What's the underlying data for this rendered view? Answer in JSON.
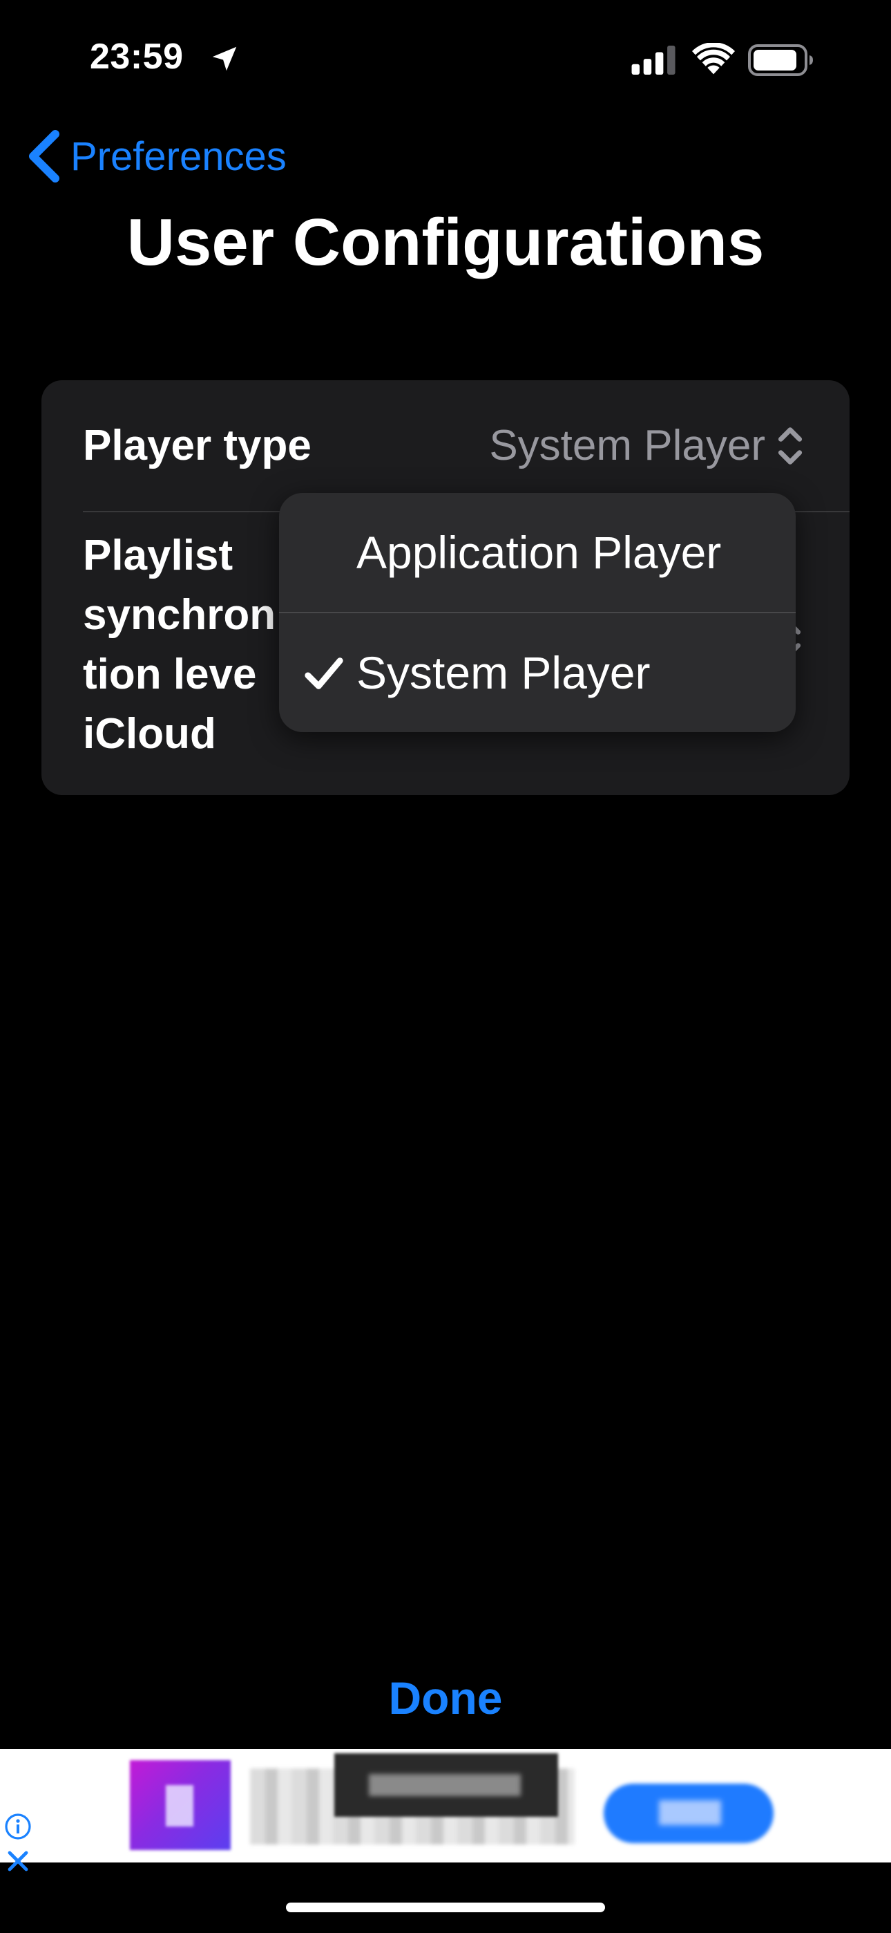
{
  "status_bar": {
    "time": "23:59",
    "icons": [
      "location-icon",
      "signal-icon",
      "wifi-icon",
      "battery-icon"
    ]
  },
  "navigation": {
    "back_label": "Preferences",
    "back_icon": "chevron-left-icon",
    "title": "User Configurations"
  },
  "settings": {
    "rows": [
      {
        "label": "Player type",
        "value": "System Player",
        "icon": "chevron-up-down-icon"
      },
      {
        "label": "Playlist synchronization level iCloud",
        "label_visible_lines": [
          "Playlist",
          "synchron",
          "tion leve",
          "iCloud"
        ],
        "icon": "chevron-up-down-icon"
      }
    ]
  },
  "dropdown": {
    "options": [
      {
        "label": "Application Player",
        "selected": false
      },
      {
        "label": "System Player",
        "selected": true
      }
    ],
    "selected_icon": "checkmark-icon"
  },
  "footer": {
    "done_label": "Done"
  },
  "ad_banner": {
    "icons": [
      "info-icon",
      "close-icon"
    ]
  },
  "colors": {
    "background": "#000000",
    "card": "#1c1c1e",
    "menu": "#2c2c2e",
    "accent": "#1a82ff",
    "secondary_text": "#98989f",
    "primary_text": "#ffffff"
  }
}
